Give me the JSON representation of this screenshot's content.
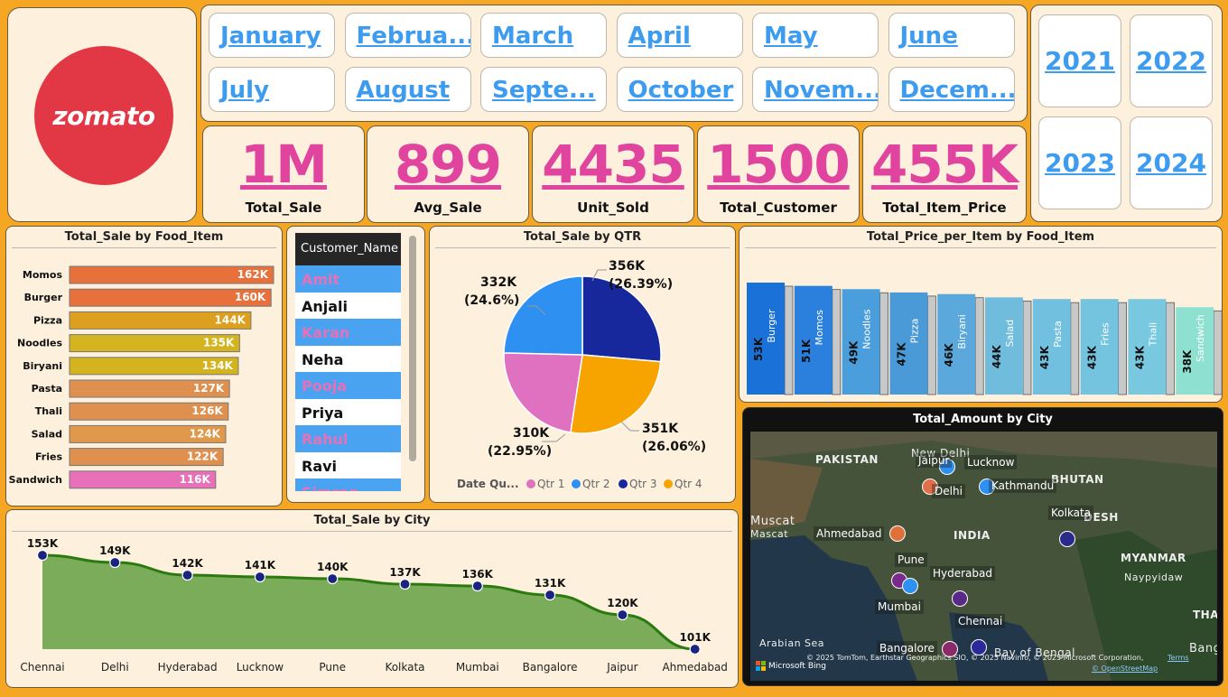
{
  "logo": {
    "text": "zomato"
  },
  "months": [
    "January",
    "Februa...",
    "March",
    "April",
    "May",
    "June",
    "July",
    "August",
    "Septe...",
    "October",
    "Novem...",
    "Decem..."
  ],
  "years": [
    "2021",
    "2022",
    "2023",
    "2024"
  ],
  "kpis": [
    {
      "value": "1M",
      "label": "Total_Sale"
    },
    {
      "value": "899",
      "label": "Avg_Sale"
    },
    {
      "value": "4435",
      "label": "Unit_Sold"
    },
    {
      "value": "1500",
      "label": "Total_Customer"
    },
    {
      "value": "455K",
      "label": "Total_Item_Price"
    }
  ],
  "food_chart": {
    "title": "Total_Sale by Food_Item",
    "colors": [
      "#e8703a",
      "#e8703a",
      "#dca01e",
      "#d4b41e",
      "#d4b41e",
      "#e0904e",
      "#e0904e",
      "#e0984a",
      "#e0904e",
      "#e870b8"
    ]
  },
  "customers": {
    "header": "Customer_Name",
    "names": [
      "Amit",
      "Anjali",
      "Karan",
      "Neha",
      "Pooja",
      "Priya",
      "Rahul",
      "Ravi",
      "Simran"
    ]
  },
  "qtr_chart": {
    "title": "Total_Sale by QTR",
    "legend_title": "Date Qu...",
    "labels": [
      {
        "value": "332K",
        "pct": "(24.6%)"
      },
      {
        "value": "356K",
        "pct": "(26.39%)"
      },
      {
        "value": "310K",
        "pct": "(22.95%)"
      },
      {
        "value": "351K",
        "pct": "(26.06%)"
      }
    ]
  },
  "price_chart": {
    "title": "Total_Price_per_Item by Food_Item"
  },
  "map": {
    "title": "Total_Amount by City",
    "cities": [
      "Jaipur",
      "Lucknow",
      "Delhi",
      "Kathmandu",
      "Kolkata",
      "Ahmedabad",
      "Pune",
      "Hyderabad",
      "Mumbai",
      "Chennai",
      "Bangalore"
    ],
    "places": [
      "PAKISTAN",
      "New Delhi",
      "BHUTAN",
      "DESH",
      "INDIA",
      "Muscat",
      "Mascat",
      "MYANMAR",
      "Naypyidaw",
      "Arabian Sea",
      "Bay of Bengal",
      "THAI",
      "Bangko"
    ],
    "attribution": "© 2025 TomTom, Earthstar Geographics SIO, © 2025 Navinfo, © 2025 Microsoft Corporation,",
    "terms": "Terms",
    "osm": "© OpenStreetMap",
    "bing": "Microsoft Bing"
  },
  "city_chart": {
    "title": "Total_Sale by City"
  },
  "chart_data": [
    {
      "type": "bar",
      "title": "Total_Sale by Food_Item",
      "orientation": "horizontal",
      "categories": [
        "Momos",
        "Burger",
        "Pizza",
        "Noodles",
        "Biryani",
        "Pasta",
        "Thali",
        "Salad",
        "Fries",
        "Sandwich"
      ],
      "values": [
        162000,
        160000,
        144000,
        135000,
        134000,
        127000,
        126000,
        124000,
        122000,
        116000
      ],
      "data_labels": [
        "162K",
        "160K",
        "144K",
        "135K",
        "134K",
        "127K",
        "126K",
        "124K",
        "122K",
        "116K"
      ]
    },
    {
      "type": "pie",
      "title": "Total_Sale by QTR",
      "categories": [
        "Qtr 1",
        "Qtr 2",
        "Qtr 3",
        "Qtr 4"
      ],
      "values": [
        310000,
        332000,
        356000,
        351000
      ],
      "colors": [
        "#e070c0",
        "#2e90f0",
        "#16289c",
        "#f7a400"
      ],
      "legend": "bottom"
    },
    {
      "type": "bar",
      "title": "Total_Price_per_Item by Food_Item",
      "categories": [
        "Burger",
        "Momos",
        "Noodles",
        "Pizza",
        "Biryani",
        "Salad",
        "Pasta",
        "Fries",
        "Thali",
        "Sandwich"
      ],
      "values": [
        53000,
        51000,
        49000,
        47000,
        46000,
        44000,
        43000,
        43000,
        43000,
        38000
      ],
      "data_labels": [
        "53K",
        "51K",
        "49K",
        "47K",
        "46K",
        "44K",
        "43K",
        "43K",
        "43K",
        "38K"
      ],
      "colors": [
        "#1a72d8",
        "#2a80dc",
        "#4b9edc",
        "#4a9ad8",
        "#5aa8dc",
        "#70bcdc",
        "#72c0e0",
        "#74c4e0",
        "#78c8e0",
        "#8ee0d0"
      ]
    },
    {
      "type": "area",
      "title": "Total_Sale by City",
      "categories": [
        "Chennai",
        "Delhi",
        "Hyderabad",
        "Lucknow",
        "Pune",
        "Kolkata",
        "Mumbai",
        "Bangalore",
        "Jaipur",
        "Ahmedabad"
      ],
      "values": [
        153000,
        149000,
        142000,
        141000,
        140000,
        137000,
        136000,
        131000,
        120000,
        101000
      ],
      "data_labels": [
        "153K",
        "149K",
        "142K",
        "141K",
        "140K",
        "137K",
        "136K",
        "131K",
        "120K",
        "101K"
      ]
    },
    {
      "type": "map",
      "title": "Total_Amount by City",
      "cities": [
        "Jaipur",
        "Lucknow",
        "Delhi",
        "Ahmedabad",
        "Kolkata",
        "Pune",
        "Hyderabad",
        "Mumbai",
        "Chennai",
        "Bangalore"
      ]
    }
  ]
}
